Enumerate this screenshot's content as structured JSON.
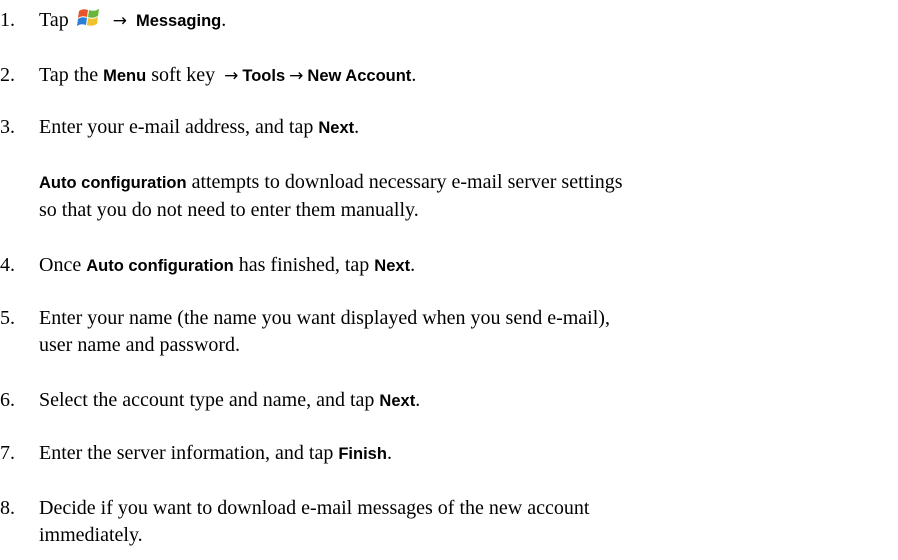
{
  "steps": [
    {
      "num": "1.",
      "a": "Tap",
      "icon": "windows-start-icon",
      "kw1": "Messaging",
      "end": "."
    },
    {
      "num": "2.",
      "a": "Tap the ",
      "kw1": "Menu",
      "b": " soft key ",
      "kw2": "Tools",
      "kw3": "New Account",
      "end": "."
    },
    {
      "num": "3.",
      "a": "Enter your e-mail address, and tap ",
      "kw1": "Next",
      "end": "."
    },
    {
      "num": "4.",
      "a": "Once ",
      "kw1": "Auto configuration",
      "b": " has finished, tap ",
      "kw2": "Next",
      "end": "."
    },
    {
      "num": "5.",
      "line1": "Enter your name (the name you want displayed when you send e-mail),",
      "line2": "user name and password."
    },
    {
      "num": "6.",
      "a": "Select the account type and name, and tap ",
      "kw1": "Next",
      "end": "."
    },
    {
      "num": "7.",
      "a": "Enter the server information, and tap ",
      "kw1": "Finish",
      "end": "."
    },
    {
      "num": "8.",
      "line1": "Decide if you want to download e-mail messages of the new account",
      "line2": "immediately."
    }
  ],
  "note": {
    "kw": "Auto configuration",
    "line1_rest": " attempts to download necessary e-mail server settings",
    "line2": "so that you do not need to enter them manually."
  },
  "arrow_symbol": "→"
}
